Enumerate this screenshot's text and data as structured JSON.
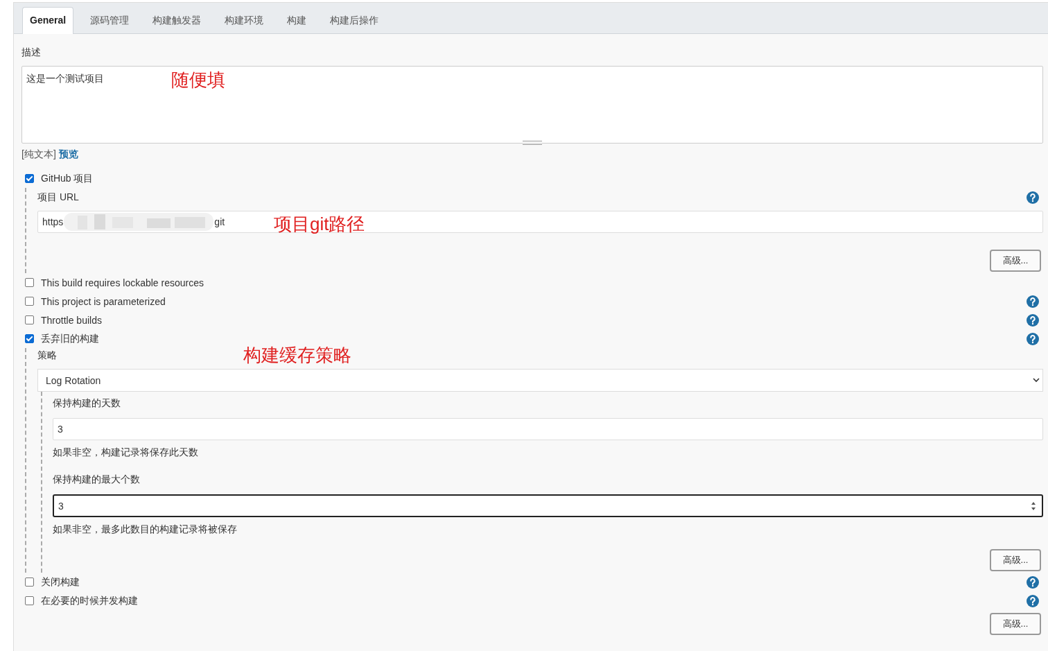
{
  "tabs": [
    {
      "label": "General",
      "selected": true
    },
    {
      "label": "源码管理",
      "selected": false
    },
    {
      "label": "构建触发器",
      "selected": false
    },
    {
      "label": "构建环境",
      "selected": false
    },
    {
      "label": "构建",
      "selected": false
    },
    {
      "label": "构建后操作",
      "selected": false
    }
  ],
  "description": {
    "label": "描述",
    "value": "这是一个测试项目",
    "annotation": "随便填",
    "format_label": "[纯文本]",
    "preview_link": "预览"
  },
  "options": [
    {
      "label": "GitHub 项目",
      "checked": true,
      "help": false,
      "details": {
        "kind": "url",
        "label": "项目 URL",
        "help": true,
        "url_start": "https",
        "url_end": "git",
        "annotation": "项目git路径",
        "advanced_button": "高级..."
      }
    },
    {
      "label": "This build requires lockable resources",
      "checked": false,
      "help": false
    },
    {
      "label": "This project is parameterized",
      "checked": false,
      "help": true
    },
    {
      "label": "Throttle builds",
      "checked": false,
      "help": true
    },
    {
      "label": "丢弃旧的构建",
      "checked": true,
      "help": true,
      "details": {
        "kind": "strategy",
        "label": "策略",
        "annotation": "构建缓存策略",
        "strategy": "Log Rotation",
        "fields": [
          {
            "kind": "text",
            "label": "保持构建的天数",
            "value": "3",
            "hint": "如果非空，构建记录将保存此天数",
            "focused": false
          },
          {
            "kind": "number",
            "label": "保持构建的最大个数",
            "value": "3",
            "hint": "如果非空，最多此数目的构建记录将被保存",
            "focused": true
          }
        ],
        "advanced_button": "高级..."
      }
    },
    {
      "label": "关闭构建",
      "checked": false,
      "help": true
    },
    {
      "label": "在必要的时候并发构建",
      "checked": false,
      "help": true
    }
  ],
  "advanced_button": "高级..."
}
